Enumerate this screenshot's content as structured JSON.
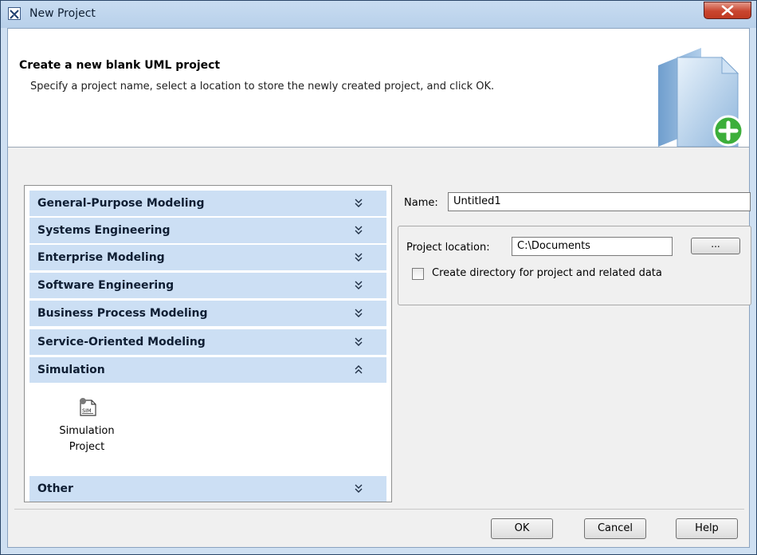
{
  "window": {
    "title": "New Project"
  },
  "header": {
    "title": "Create a new blank UML project",
    "description": "Specify a project name, select a location to store the newly created project, and click OK."
  },
  "categories": [
    {
      "label": "General-Purpose Modeling",
      "expanded": false
    },
    {
      "label": "Systems Engineering",
      "expanded": false
    },
    {
      "label": "Enterprise Modeling",
      "expanded": false
    },
    {
      "label": "Software Engineering",
      "expanded": false
    },
    {
      "label": "Business Process Modeling",
      "expanded": false
    },
    {
      "label": "Service-Oriented Modeling",
      "expanded": false
    },
    {
      "label": "Simulation",
      "expanded": true
    },
    {
      "label": "Other",
      "expanded": false
    }
  ],
  "simulation_items": [
    {
      "label_line1": "Simulation",
      "label_line2": "Project",
      "icon": "sim-project-icon",
      "icon_text": "SIM"
    }
  ],
  "form": {
    "name_label": "Name:",
    "name_value": "Untitled1",
    "location_label": "Project location:",
    "location_value": "C:\\Documents",
    "browse_label": "...",
    "create_dir_label": "Create directory for project and related data",
    "create_dir_checked": false
  },
  "buttons": {
    "ok": "OK",
    "cancel": "Cancel",
    "help": "Help"
  },
  "colors": {
    "category_bg": "#ccdff4",
    "title_bar": "#c8dcf1",
    "close_button": "#c9452f",
    "plus_badge": "#3cae3a"
  }
}
